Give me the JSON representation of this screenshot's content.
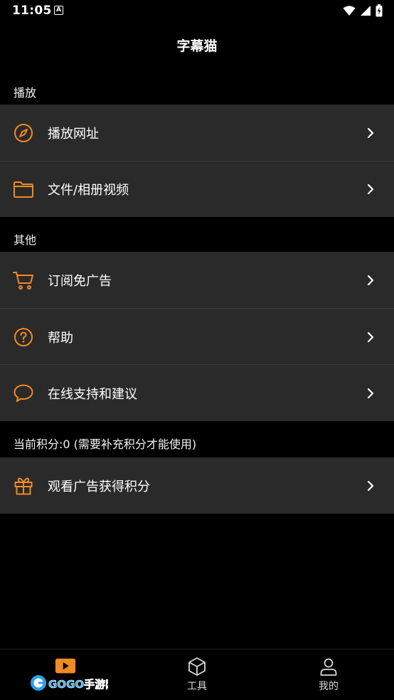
{
  "status_bar": {
    "time": "11:05",
    "indicator": "A"
  },
  "app": {
    "title": "字幕猫",
    "accent_color": "#F08A24"
  },
  "sections": {
    "play": {
      "header": "播放",
      "items": [
        {
          "label": "播放网址",
          "icon": "compass-icon"
        },
        {
          "label": "文件/相册视频",
          "icon": "folder-icon"
        }
      ]
    },
    "other": {
      "header": "其他",
      "items": [
        {
          "label": "订阅免广告",
          "icon": "cart-icon"
        },
        {
          "label": "帮助",
          "icon": "help-circle-icon"
        },
        {
          "label": "在线支持和建议",
          "icon": "chat-bubble-icon"
        }
      ]
    },
    "points": {
      "header": "当前积分:0 (需要补充积分才能使用)",
      "items": [
        {
          "label": "观看广告获得积分",
          "icon": "gift-icon"
        }
      ]
    }
  },
  "tabs": [
    {
      "label": "",
      "icon": "play-icon",
      "active": true
    },
    {
      "label": "工具",
      "icon": "cube-icon"
    },
    {
      "label": "我的",
      "icon": "user-icon"
    }
  ],
  "watermark": {
    "text": "GOGO手游网"
  }
}
